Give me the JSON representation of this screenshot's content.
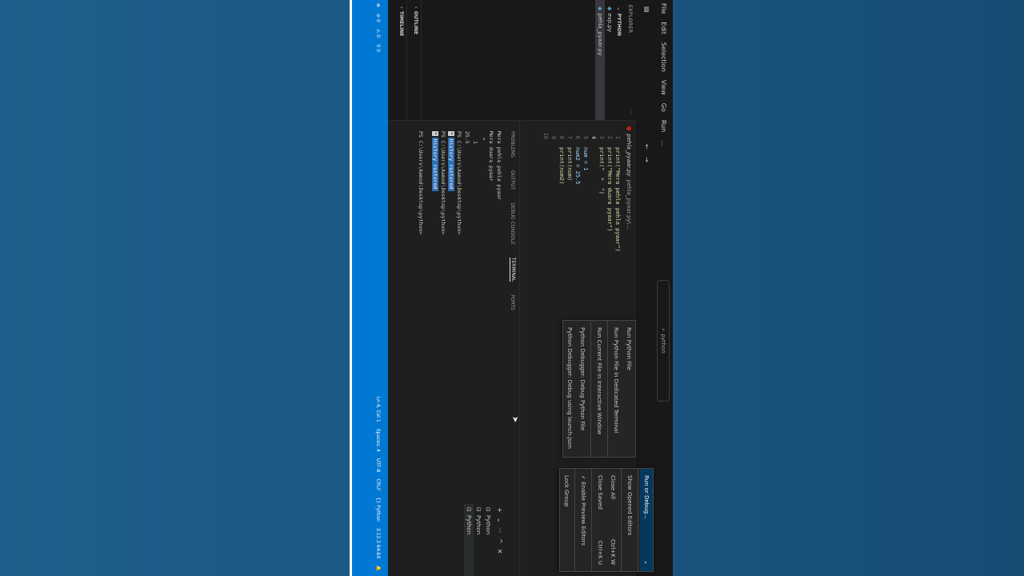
{
  "menu_bar": {
    "items": [
      "File",
      "Edit",
      "Selection",
      "View",
      "Go",
      "Run",
      "..."
    ],
    "search_text": "python"
  },
  "explorer": {
    "header": "EXPLORER",
    "folder": "PYTHON",
    "files": [
      "evp.py",
      "pehla_pyaar.py"
    ],
    "outline": "OUTLINE",
    "timeline": "TIMELINE"
  },
  "editor": {
    "breadcrumb_file": "pehla_pyaar.py",
    "breadcrumb_rest": "pehla_pyaar.py\\...",
    "lines": [
      {
        "n": "1",
        "text": "print(\"Mera pehla pehla pyaar\")"
      },
      {
        "n": "2",
        "text": "print(\"Mera duara pyaar\")"
      },
      {
        "n": "3",
        "text": "print(\"  *  \")"
      },
      {
        "n": "4",
        "text": ""
      },
      {
        "n": "5",
        "text": "num = 1"
      },
      {
        "n": "6",
        "text": "num2 = 25.5"
      },
      {
        "n": "7",
        "text": "print(num)"
      },
      {
        "n": "8",
        "text": "print(num2)"
      },
      {
        "n": "9",
        "text": ""
      },
      {
        "n": "10",
        "text": ""
      }
    ]
  },
  "panel": {
    "tabs": [
      "PROBLEMS",
      "OUTPUT",
      "DEBUG CONSOLE",
      "TERMINAL",
      "PORTS"
    ],
    "terminal_lines": [
      "Mera pehla pehla pyaar",
      "Mera duara pyaar",
      "  *",
      "1",
      "25.5",
      "PS C:\\Users\\Aamod\\Desktop\\python>",
      "History restored",
      "PS C:\\Users\\Aamod\\Desktop\\python>",
      "History restored",
      "PS C:\\Users\\Aamod\\Desktop\\python>"
    ],
    "terminal_list": [
      "Python",
      "Python",
      "Python"
    ]
  },
  "run_menu": {
    "items": [
      "Run Python File",
      "Run Python File in Dedicated Terminal",
      "Run Current File in Interactive Window",
      "Python Debugger: Debug Python File",
      "Python Debugger: Debug using launch.json"
    ]
  },
  "tab_menu": {
    "items": [
      {
        "label": "Run or Debug...",
        "shortcut": ""
      },
      {
        "label": "Show Opened Editors",
        "shortcut": ""
      },
      {
        "label": "Close All",
        "shortcut": "Ctrl+K W"
      },
      {
        "label": "Close Saved",
        "shortcut": "Ctrl+K U"
      },
      {
        "label": "Enable Preview Editors",
        "shortcut": ""
      },
      {
        "label": "Lock Group",
        "shortcut": ""
      }
    ]
  },
  "status": {
    "errors": "0",
    "warnings": "0",
    "ports": "0",
    "position": "Ln 4, Col 1",
    "spaces": "Spaces: 4",
    "encoding": "UTF-8",
    "eol": "CRLF",
    "language": "Python",
    "interpreter": "3.12.3 64-bit"
  },
  "colors": {
    "accent": "#0078d4",
    "editor_bg": "#1f1f1f",
    "background": "#1a5680"
  }
}
